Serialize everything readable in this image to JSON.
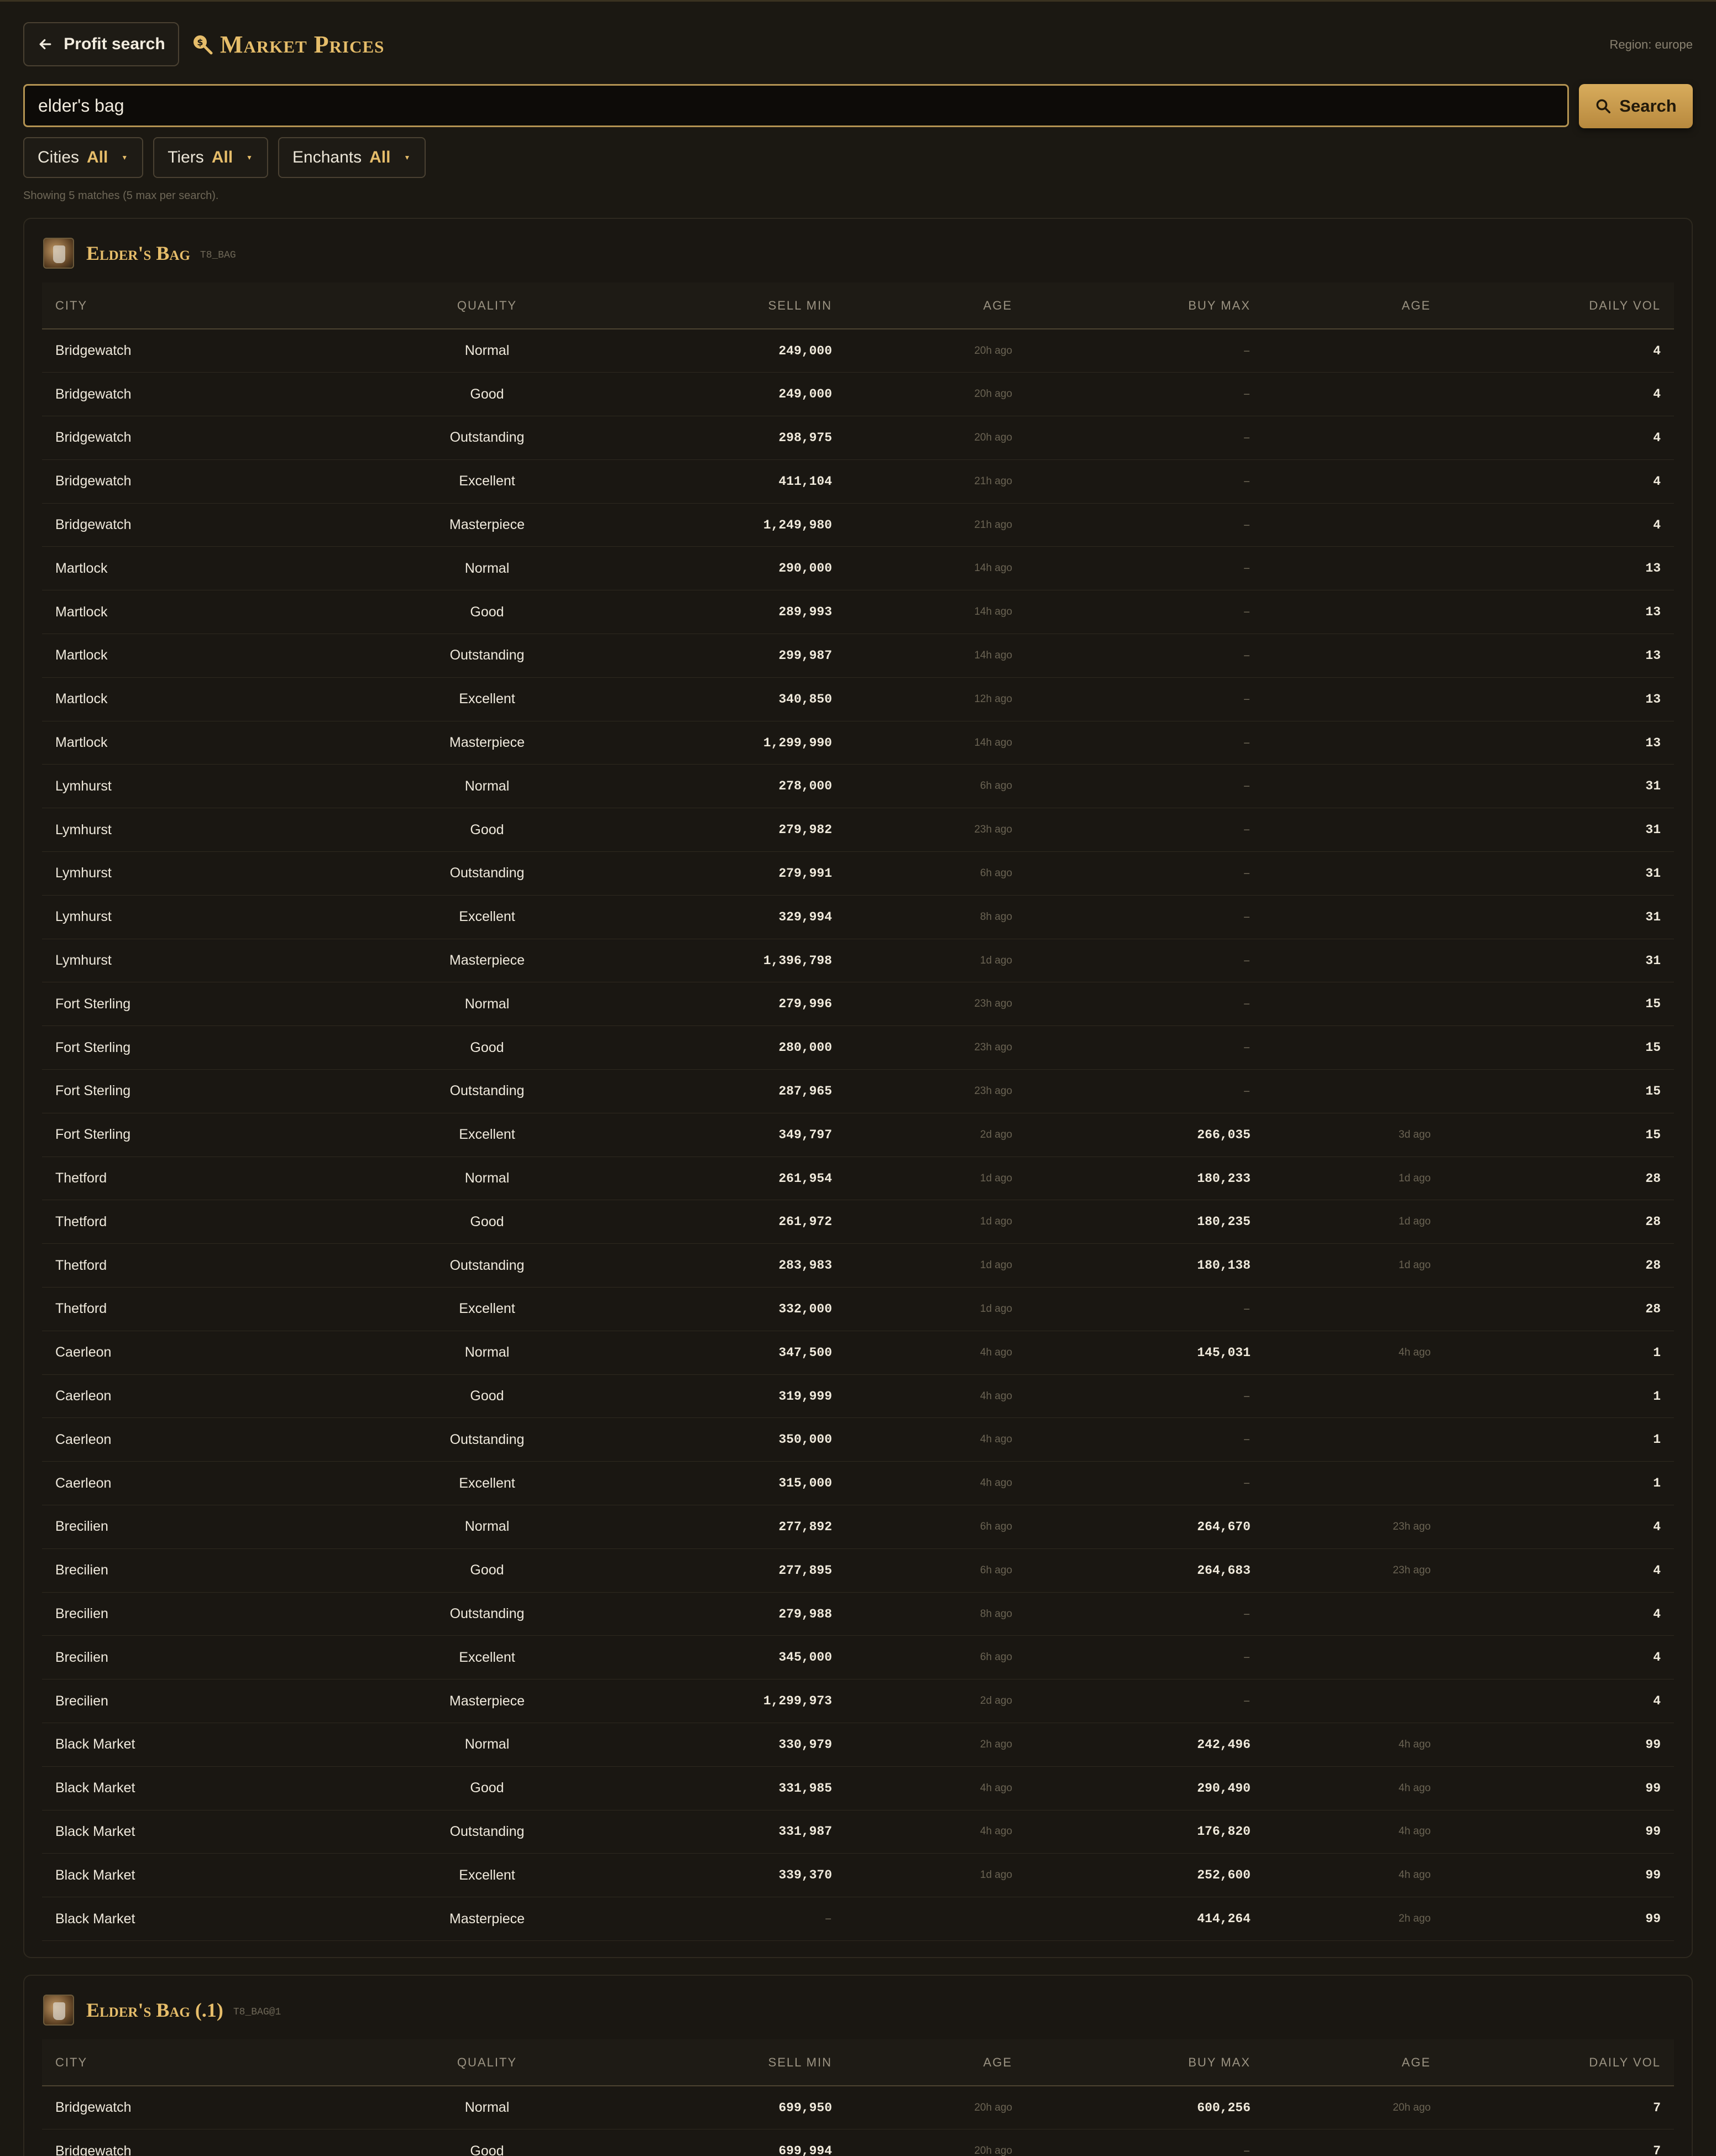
{
  "header": {
    "back_label": "Profit search",
    "title": "Market Prices",
    "region": "Region: europe"
  },
  "search": {
    "value": "elder's bag",
    "button_label": "Search"
  },
  "filters": [
    {
      "label": "Cities",
      "value": "All"
    },
    {
      "label": "Tiers",
      "value": "All"
    },
    {
      "label": "Enchants",
      "value": "All"
    }
  ],
  "matches_text": "Showing 5 matches (5 max per search).",
  "columns": [
    "CITY",
    "QUALITY",
    "SELL MIN",
    "AGE",
    "BUY MAX",
    "AGE",
    "DAILY VOL"
  ],
  "items": [
    {
      "name": "Elder's Bag",
      "code": "T8_BAG",
      "rows": [
        [
          "Bridgewatch",
          "Normal",
          "249,000",
          "20h ago",
          "–",
          "",
          "4"
        ],
        [
          "Bridgewatch",
          "Good",
          "249,000",
          "20h ago",
          "–",
          "",
          "4"
        ],
        [
          "Bridgewatch",
          "Outstanding",
          "298,975",
          "20h ago",
          "–",
          "",
          "4"
        ],
        [
          "Bridgewatch",
          "Excellent",
          "411,104",
          "21h ago",
          "–",
          "",
          "4"
        ],
        [
          "Bridgewatch",
          "Masterpiece",
          "1,249,980",
          "21h ago",
          "–",
          "",
          "4"
        ],
        [
          "Martlock",
          "Normal",
          "290,000",
          "14h ago",
          "–",
          "",
          "13"
        ],
        [
          "Martlock",
          "Good",
          "289,993",
          "14h ago",
          "–",
          "",
          "13"
        ],
        [
          "Martlock",
          "Outstanding",
          "299,987",
          "14h ago",
          "–",
          "",
          "13"
        ],
        [
          "Martlock",
          "Excellent",
          "340,850",
          "12h ago",
          "–",
          "",
          "13"
        ],
        [
          "Martlock",
          "Masterpiece",
          "1,299,990",
          "14h ago",
          "–",
          "",
          "13"
        ],
        [
          "Lymhurst",
          "Normal",
          "278,000",
          "6h ago",
          "–",
          "",
          "31"
        ],
        [
          "Lymhurst",
          "Good",
          "279,982",
          "23h ago",
          "–",
          "",
          "31"
        ],
        [
          "Lymhurst",
          "Outstanding",
          "279,991",
          "6h ago",
          "–",
          "",
          "31"
        ],
        [
          "Lymhurst",
          "Excellent",
          "329,994",
          "8h ago",
          "–",
          "",
          "31"
        ],
        [
          "Lymhurst",
          "Masterpiece",
          "1,396,798",
          "1d ago",
          "–",
          "",
          "31"
        ],
        [
          "Fort Sterling",
          "Normal",
          "279,996",
          "23h ago",
          "–",
          "",
          "15"
        ],
        [
          "Fort Sterling",
          "Good",
          "280,000",
          "23h ago",
          "–",
          "",
          "15"
        ],
        [
          "Fort Sterling",
          "Outstanding",
          "287,965",
          "23h ago",
          "–",
          "",
          "15"
        ],
        [
          "Fort Sterling",
          "Excellent",
          "349,797",
          "2d ago",
          "266,035",
          "3d ago",
          "15"
        ],
        [
          "Thetford",
          "Normal",
          "261,954",
          "1d ago",
          "180,233",
          "1d ago",
          "28"
        ],
        [
          "Thetford",
          "Good",
          "261,972",
          "1d ago",
          "180,235",
          "1d ago",
          "28"
        ],
        [
          "Thetford",
          "Outstanding",
          "283,983",
          "1d ago",
          "180,138",
          "1d ago",
          "28"
        ],
        [
          "Thetford",
          "Excellent",
          "332,000",
          "1d ago",
          "–",
          "",
          "28"
        ],
        [
          "Caerleon",
          "Normal",
          "347,500",
          "4h ago",
          "145,031",
          "4h ago",
          "1"
        ],
        [
          "Caerleon",
          "Good",
          "319,999",
          "4h ago",
          "–",
          "",
          "1"
        ],
        [
          "Caerleon",
          "Outstanding",
          "350,000",
          "4h ago",
          "–",
          "",
          "1"
        ],
        [
          "Caerleon",
          "Excellent",
          "315,000",
          "4h ago",
          "–",
          "",
          "1"
        ],
        [
          "Brecilien",
          "Normal",
          "277,892",
          "6h ago",
          "264,670",
          "23h ago",
          "4"
        ],
        [
          "Brecilien",
          "Good",
          "277,895",
          "6h ago",
          "264,683",
          "23h ago",
          "4"
        ],
        [
          "Brecilien",
          "Outstanding",
          "279,988",
          "8h ago",
          "–",
          "",
          "4"
        ],
        [
          "Brecilien",
          "Excellent",
          "345,000",
          "6h ago",
          "–",
          "",
          "4"
        ],
        [
          "Brecilien",
          "Masterpiece",
          "1,299,973",
          "2d ago",
          "–",
          "",
          "4"
        ],
        [
          "Black Market",
          "Normal",
          "330,979",
          "2h ago",
          "242,496",
          "4h ago",
          "99"
        ],
        [
          "Black Market",
          "Good",
          "331,985",
          "4h ago",
          "290,490",
          "4h ago",
          "99"
        ],
        [
          "Black Market",
          "Outstanding",
          "331,987",
          "4h ago",
          "176,820",
          "4h ago",
          "99"
        ],
        [
          "Black Market",
          "Excellent",
          "339,370",
          "1d ago",
          "252,600",
          "4h ago",
          "99"
        ],
        [
          "Black Market",
          "Masterpiece",
          "–",
          "",
          "414,264",
          "2h ago",
          "99"
        ]
      ]
    },
    {
      "name": "Elder's Bag (.1)",
      "code": "T8_BAG@1",
      "rows": [
        [
          "Bridgewatch",
          "Normal",
          "699,950",
          "20h ago",
          "600,256",
          "20h ago",
          "7"
        ],
        [
          "Bridgewatch",
          "Good",
          "699,994",
          "20h ago",
          "–",
          "",
          "7"
        ]
      ]
    }
  ]
}
